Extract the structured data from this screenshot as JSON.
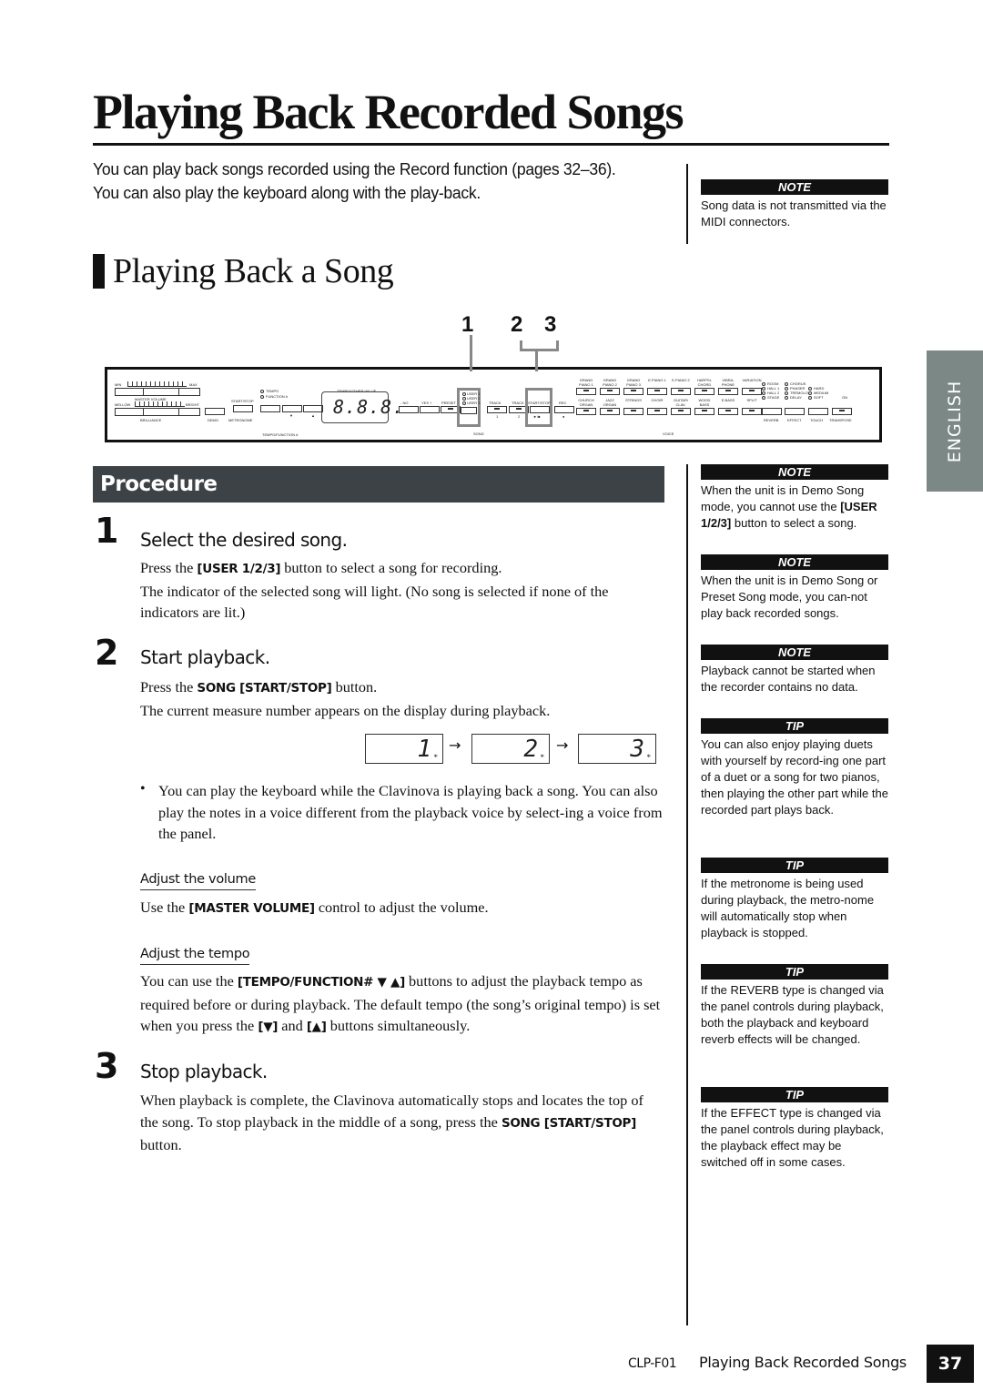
{
  "header": {
    "title": "Playing Back Recorded Songs",
    "intro": "You can play back songs recorded using the Record function (pages 32–36). You can also play the keyboard along with the play-back."
  },
  "section": {
    "heading": "Playing Back a Song",
    "callouts": [
      "1",
      "2",
      "3"
    ]
  },
  "panel": {
    "master_volume": {
      "min": "MIN",
      "max": "MAX",
      "label": "MASTER VOLUME"
    },
    "brilliance": {
      "left": "MELLOW",
      "right": "BRIGHT",
      "label": "BRILLIANCE"
    },
    "demo": "DEMO",
    "metronome_top": "START/STOP",
    "metronome": "METRONOME",
    "tempo_led": "TEMPO",
    "function_led": "FUNCTION #",
    "tempo_function": "TEMPO/FUNCTION #",
    "down": "▼",
    "up": "▲",
    "display_label": "TEMPO/OTHER VALUE",
    "display_value": "8.8.8.",
    "no": "- NO",
    "yes": "YES +",
    "preset": "PRESET",
    "users": [
      "USER 1",
      "USER 2",
      "USER 3"
    ],
    "track1": "TRACK",
    "track1_num": "1",
    "track2": "TRACK",
    "track2_num": "2",
    "start_stop": "START/STOP",
    "play_pause": "►/■",
    "rec": "REC",
    "rec_symbol": "●",
    "song": "SONG",
    "voices_row1": [
      "GRAND PIANO 1",
      "GRAND PIANO 2",
      "GRAND PIANO 3",
      "E.PIANO 1",
      "E.PIANO 2",
      "HARPSI-CHORD",
      "VIBRA-PHONE",
      "VARIATION"
    ],
    "voices_row2": [
      "CHURCH ORGAN",
      "JAZZ ORGAN",
      "STRINGS",
      "CHOIR",
      "GUITAR/ CLAV.",
      "WOOD BASS",
      "E.BASS",
      "SPLIT"
    ],
    "voice": "VOICE",
    "reverb_options": [
      "ROOM",
      "HALL 1",
      "HALL 2",
      "STAGE"
    ],
    "effect_options": [
      "CHORUS",
      "PHASER",
      "TREMOLO",
      "DELAY"
    ],
    "touch_options": [
      "HARD",
      "MEDIUM",
      "SOFT"
    ],
    "transpose_on": "ON",
    "reverb": "REVERB",
    "effect": "EFFECT",
    "touch": "TOUCH",
    "transpose": "TRANSPOSE"
  },
  "procedure": {
    "label": "Procedure",
    "steps": [
      {
        "num": "1",
        "title": "Select the desired song.",
        "line1_pre": "Press the ",
        "line1_bold": "[USER 1/2/3]",
        "line1_post": " button to select a song for recording.",
        "line2": "The indicator of the selected song will light. (No song is selected if none of the indicators are lit.)"
      },
      {
        "num": "2",
        "title": "Start playback.",
        "line1_pre": "Press the ",
        "line1_bold": "SONG [START/STOP]",
        "line1_post": " button.",
        "line2": "The current measure number appears on the display during playback.",
        "displays": [
          "1",
          "2",
          "3"
        ],
        "display_marker": "*",
        "arrow": "→"
      },
      {
        "num": "3",
        "title": "Stop playback.",
        "line1_pre": "When playback is complete, the Clavinova automatically stops and locates the top of the song. To stop playback in the middle of a song, press the ",
        "line1_bold": "SONG [START/STOP]",
        "line1_post": " button."
      }
    ],
    "bullet": {
      "mark": "•",
      "text": "You can play the keyboard while the Clavinova is playing back a song. You can also play the notes in a voice different from the playback voice by select-ing a voice from the panel."
    },
    "volume": {
      "heading": "Adjust the volume",
      "pre": "Use the ",
      "bold": "[MASTER VOLUME]",
      "post": " control to adjust the volume."
    },
    "tempo": {
      "heading": "Adjust the tempo",
      "pre": "You can use the ",
      "bold": "[TEMPO/FUNCTION# ▼ ▲]",
      "mid": " buttons to adjust the playback tempo as required before or during playback. The default tempo (the song’s original tempo) is set when you press the ",
      "bold2": "[▼]",
      "and": " and ",
      "bold3": "[▲]",
      "post": " buttons simultaneously."
    }
  },
  "sidebar": {
    "notes": [
      {
        "label": "NOTE",
        "text": "Song data is not transmitted via the MIDI connectors."
      },
      {
        "label": "NOTE",
        "text_pre": "When the unit is in Demo Song mode, you cannot use the ",
        "text_bold": "[USER 1/2/3]",
        "text_post": " button to select a song."
      },
      {
        "label": "NOTE",
        "text": "When the unit is in Demo Song or Preset Song mode, you can-not play back recorded songs."
      },
      {
        "label": "NOTE",
        "text": "Playback cannot be started when the recorder contains no data."
      },
      {
        "label": "TIP",
        "text": "You can also enjoy playing duets with yourself by record-ing one part of a duet or a song for two pianos, then playing the other part while the recorded part plays back."
      },
      {
        "label": "TIP",
        "text": "If the metronome is being used during playback, the metro-nome will automatically stop when playback is stopped."
      },
      {
        "label": "TIP",
        "text": "If the REVERB type is changed via the panel controls during playback, both the playback and keyboard reverb effects will be changed."
      },
      {
        "label": "TIP",
        "text": "If the EFFECT type is changed via the panel controls during playback, the playback effect may be switched off in some cases."
      }
    ]
  },
  "language_tab": "ENGLISH",
  "footer": {
    "model": "CLP-F01",
    "title": "Playing Back Recorded Songs",
    "page": "37"
  }
}
